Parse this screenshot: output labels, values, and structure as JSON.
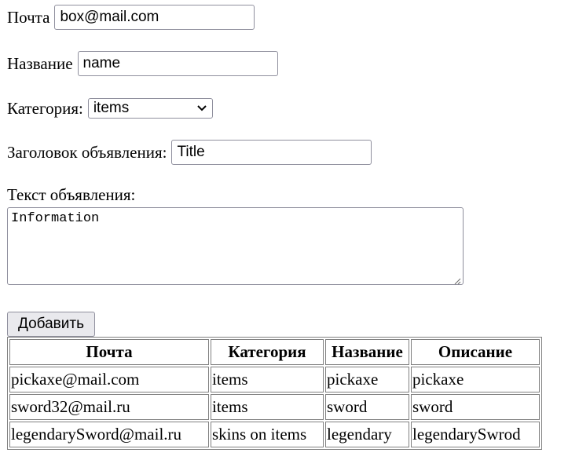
{
  "form": {
    "email": {
      "label": "Почта",
      "value": "box@mail.com"
    },
    "name": {
      "label": "Название",
      "value": "name"
    },
    "category": {
      "label": "Категория:",
      "selected": "items"
    },
    "title": {
      "label": "Заголовок объявления:",
      "value": "Title"
    },
    "text": {
      "label": "Текст объявления:",
      "value": "Information"
    },
    "submit_label": "Добавить"
  },
  "table": {
    "headers": [
      "Почта",
      "Категория",
      "Название",
      "Описание"
    ],
    "rows": [
      [
        "pickaxe@mail.com",
        "items",
        "pickaxe",
        "pickaxe"
      ],
      [
        "sword32@mail.ru",
        "items",
        "sword",
        "sword"
      ],
      [
        "legendarySword@mail.ru",
        "skins on items",
        "legendary",
        "legendarySwrod"
      ]
    ]
  },
  "icons": {
    "select_arrow": "chevron-down-icon",
    "resize_grip": "resize-grip-icon"
  }
}
